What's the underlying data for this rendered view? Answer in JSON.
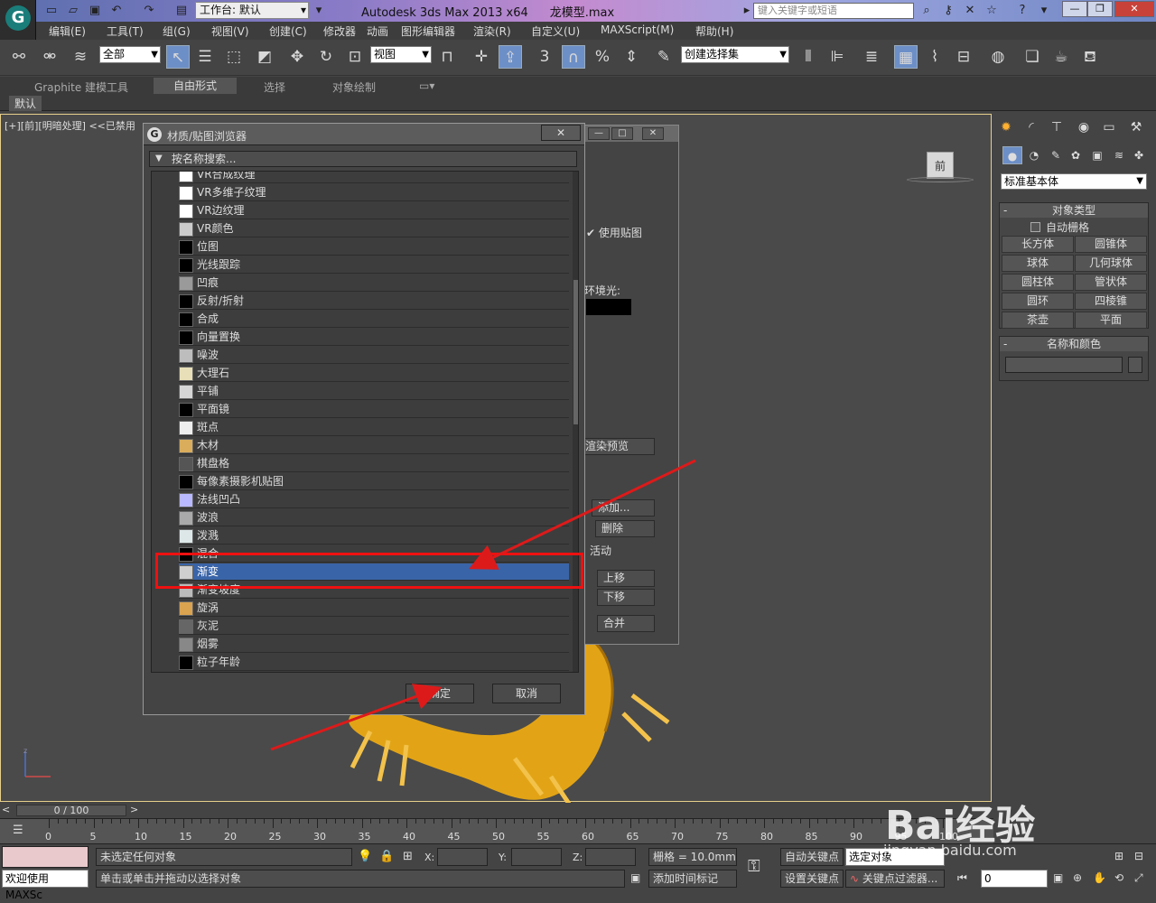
{
  "window": {
    "title": "Autodesk 3ds Max  2013 x64",
    "file": "龙模型.max",
    "workspace": "工作台: 默认",
    "search_placeholder": "键入关键字或短语"
  },
  "menu": [
    "编辑(E)",
    "工具(T)",
    "组(G)",
    "视图(V)",
    "创建(C)",
    "修改器",
    "动画",
    "图形编辑器",
    "渲染(R)",
    "自定义(U)",
    "MAXScript(M)",
    "帮助(H)"
  ],
  "toolbar": {
    "filter": "全部",
    "ref_coord": "视图",
    "named_sel": "创建选择集",
    "snap_labels": [
      "3",
      "%"
    ]
  },
  "ribbon": {
    "tabs": [
      "Graphite 建模工具",
      "自由形式",
      "选择",
      "对象绘制"
    ],
    "active": "自由形式",
    "sub": "默认"
  },
  "viewport": {
    "label": "[+][前][明暗处理] <<已禁用",
    "viewcube": "前"
  },
  "right_panel": {
    "dropdown": "标准基本体",
    "rollout1_title": "对象类型",
    "autogrid": "自动栅格",
    "buttons": [
      "长方体",
      "圆锥体",
      "球体",
      "几何球体",
      "圆柱体",
      "管状体",
      "圆环",
      "四棱锥",
      "茶壶",
      "平面"
    ],
    "rollout2_title": "名称和颜色"
  },
  "browser": {
    "title": "材质/贴图浏览器",
    "search": "按名称搜索...",
    "items": [
      {
        "label": "VR合成纹理",
        "swatch": "#ffffff"
      },
      {
        "label": "VR多维子纹理",
        "swatch": "#ffffff"
      },
      {
        "label": "VR边纹理",
        "swatch": "#ffffff"
      },
      {
        "label": "VR颜色",
        "swatch": "#cccccc"
      },
      {
        "label": "位图",
        "swatch": "#000000"
      },
      {
        "label": "光线跟踪",
        "swatch": "#000000"
      },
      {
        "label": "凹痕",
        "swatch": "#9a9a9a"
      },
      {
        "label": "反射/折射",
        "swatch": "#000000"
      },
      {
        "label": "合成",
        "swatch": "#000000"
      },
      {
        "label": "向量置换",
        "swatch": "#000000"
      },
      {
        "label": "噪波",
        "swatch": "#bdbdbd"
      },
      {
        "label": "大理石",
        "swatch": "#e8dfb8"
      },
      {
        "label": "平铺",
        "swatch": "#d6d6d6"
      },
      {
        "label": "平面镜",
        "swatch": "#000000"
      },
      {
        "label": "斑点",
        "swatch": "#eeeeee"
      },
      {
        "label": "木材",
        "swatch": "#d9ad5c"
      },
      {
        "label": "棋盘格",
        "swatch": "#555555"
      },
      {
        "label": "每像素摄影机贴图",
        "swatch": "#000000"
      },
      {
        "label": "法线凹凸",
        "swatch": "#b9b9ff"
      },
      {
        "label": "波浪",
        "swatch": "#aaaaaa"
      },
      {
        "label": "泼溅",
        "swatch": "#dde7e7"
      },
      {
        "label": "混合",
        "swatch": "#000000"
      },
      {
        "label": "渐变",
        "swatch": "#cfcfcf"
      },
      {
        "label": "渐变坡度",
        "swatch": "#bbbbbb"
      },
      {
        "label": "旋涡",
        "swatch": "#d9a350"
      },
      {
        "label": "灰泥",
        "swatch": "#666666"
      },
      {
        "label": "烟雾",
        "swatch": "#888888"
      },
      {
        "label": "粒子年龄",
        "swatch": "#000000"
      }
    ],
    "selected": "渐变",
    "ok": "确定",
    "cancel": "取消"
  },
  "material_editor": {
    "use_map": "使用贴图",
    "ambient": "环境光:",
    "render_preview": "渲染预览",
    "add": "添加...",
    "delete": "删除",
    "active": "活动",
    "move_up": "上移",
    "move_down": "下移",
    "merge": "合并"
  },
  "timeline": {
    "frame": "0 / 100",
    "ticks": [
      "0",
      "5",
      "10",
      "15",
      "20",
      "25",
      "30",
      "35",
      "40",
      "45",
      "50",
      "55",
      "60",
      "65",
      "70",
      "75",
      "80",
      "85",
      "90",
      "95",
      "100"
    ]
  },
  "status": {
    "selection": "未选定任何对象",
    "prompt": "单击或单击并拖动以选择对象",
    "welcome": "欢迎使用 MAXSc",
    "grid": "栅格 = 10.0mm",
    "add_time_tag": "添加时间标记",
    "auto_key": "自动关键点",
    "set_key": "设置关键点",
    "sel_obj": "选定对象",
    "key_filter": "关键点过滤器...",
    "frame_val": "0",
    "x": "X:",
    "y": "Y:",
    "z": "Z:"
  },
  "watermark": {
    "text": "Bai经验",
    "url": "jingyan.baidu.com"
  },
  "colors": {
    "accent": "#3a64a8",
    "highlight": "#e11111",
    "arrow": "#dd1a1a"
  }
}
